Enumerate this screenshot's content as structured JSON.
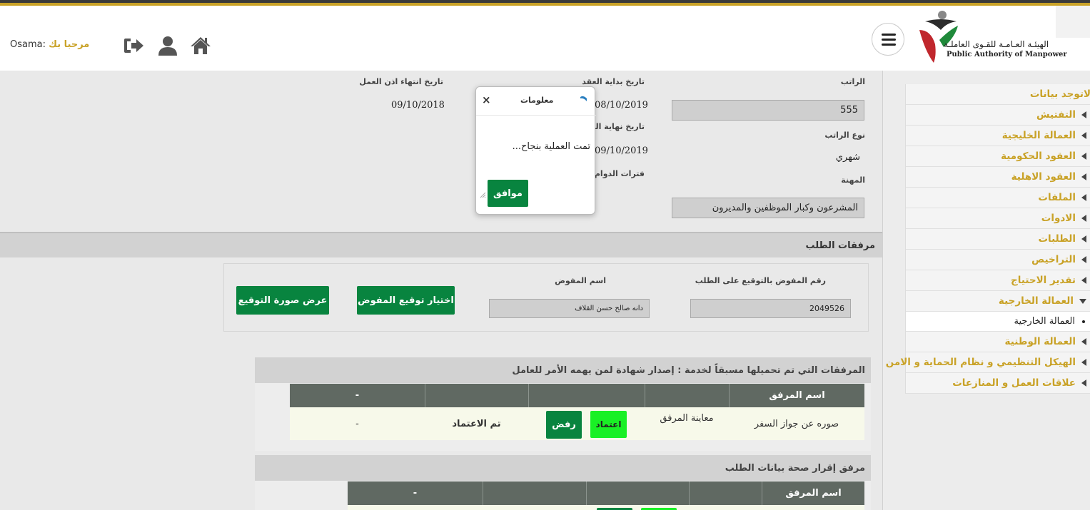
{
  "header": {
    "greeting_user": "Osama:",
    "greeting_hello": "مرحبا بك",
    "logo_ar": "الهيئـة العـامـة للقـوى العاملـة",
    "logo_en": "Public Authority of Manpower"
  },
  "sidebar": {
    "items": [
      {
        "label": "لاتوجد بيانات"
      },
      {
        "label": "التفتيش"
      },
      {
        "label": "العمالة الخليجية"
      },
      {
        "label": "العقود الحكومية"
      },
      {
        "label": "العقود الاهلية"
      },
      {
        "label": "الملفات"
      },
      {
        "label": "الادوات"
      },
      {
        "label": "الطلبات"
      },
      {
        "label": "التراخيص"
      },
      {
        "label": "تقدير الاحتياج"
      },
      {
        "label": "العمالة الخارجية"
      },
      {
        "label": "العمالة الخارجية"
      },
      {
        "label": "العمالة الوطنية"
      },
      {
        "label": "الهيكل التنظيمي و نظام الحماية و الامن"
      },
      {
        "label": "علاقات العمل و المنازعات"
      }
    ]
  },
  "details": {
    "salary_label": "الراتب",
    "salary_value": "555",
    "salary_type_label": "نوع الراتب",
    "salary_type_value": "شهري",
    "profession_label": "المهنة",
    "profession_value": "المشرعون وكبار الموظفين والمديرون",
    "contract_start_label": "تاريخ بداية العقد",
    "contract_start_value": "08/10/2019",
    "contract_end_label": "تاريخ نهاية العقد",
    "contract_end_value": "09/10/2019",
    "shifts_label": "فترات الدوام",
    "permit_end_label": "تاريخ انتهاء اذن العمل",
    "permit_end_value": "09/10/2018"
  },
  "attachments": {
    "section_title": "مرفقات الطلب",
    "authorized_number_label": "رقم المفوض بالتوقيع على الطلب",
    "authorized_number_value": "2049526",
    "authorized_name_label": "اسم المفوض",
    "authorized_name_value": "دانه صالح حسن القلاف",
    "choose_signature_button": "اختيار توقيع المفوض",
    "view_signature_button": "عرض صورة التوقيع"
  },
  "uploaded_panel": {
    "title": "المرفقات التي تم تحميلها مسبقاً لخدمة : إصدار شهادة لمن يهمه الأمر للعامل",
    "headers": [
      "اسم المرفق",
      "",
      "",
      "",
      "-"
    ],
    "row": {
      "name": "صوره عن جواز السفر",
      "preview": "معاينة المرفق",
      "approve": "اعتماد",
      "reject": "رفض",
      "status": "تم الاعتماد",
      "last": "-"
    }
  },
  "declaration_panel": {
    "title": "مرفق إقرار صحة بيانات الطلب",
    "headers": [
      "اسم المرفق",
      "",
      "",
      "",
      "-"
    ]
  },
  "modal": {
    "title": "معلومات",
    "close": "×",
    "message": "تمت العملية بنجاح...",
    "ok_button": "موافق"
  },
  "colors": {
    "gold": "#c9a227",
    "green": "#08843f",
    "light_green": "#19f025",
    "table_header": "#606962"
  }
}
